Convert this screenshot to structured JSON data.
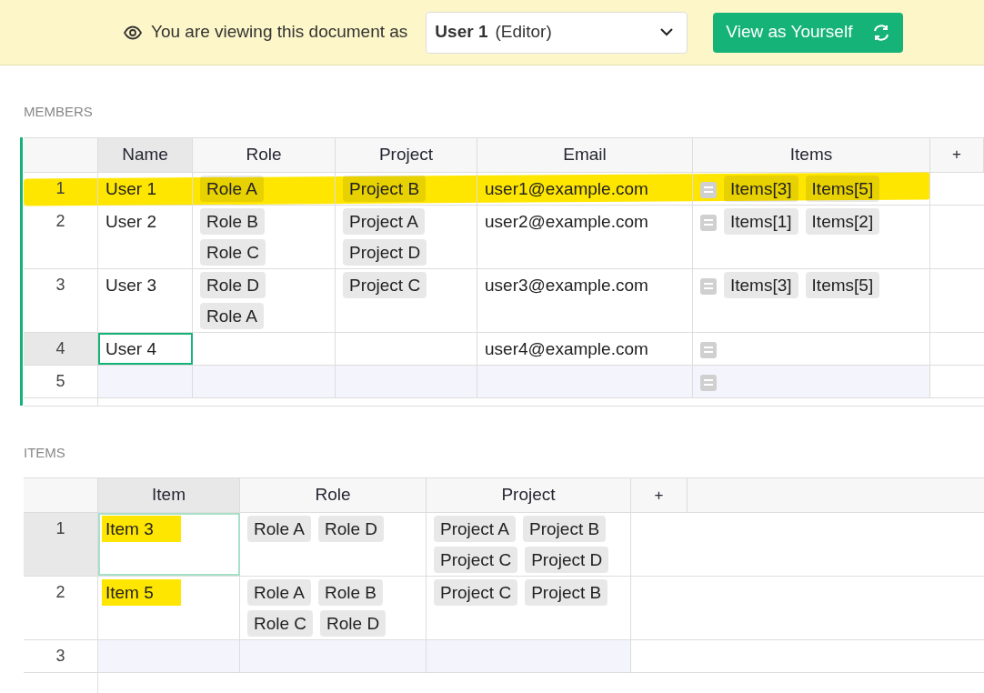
{
  "banner": {
    "message": "You are viewing this document as",
    "viewer": {
      "name": "User 1",
      "role": "(Editor)"
    },
    "button": "View as Yourself"
  },
  "tables": [
    {
      "title": "MEMBERS",
      "active": true,
      "add_column": "+",
      "columns": [
        {
          "label": "Name",
          "kind": "text",
          "selected": true
        },
        {
          "label": "Role",
          "kind": "chips",
          "selected": false
        },
        {
          "label": "Project",
          "kind": "chips",
          "selected": false
        },
        {
          "label": "Email",
          "kind": "text",
          "selected": false
        },
        {
          "label": "Items",
          "kind": "refs",
          "selected": false
        }
      ],
      "rows": [
        {
          "number": "1",
          "kind": "data",
          "selected": false,
          "highlighted": true,
          "cells": [
            "User 1",
            [
              "Role A"
            ],
            [
              "Project B"
            ],
            "user1@example.com",
            [
              "Items[3]",
              "Items[5]"
            ]
          ]
        },
        {
          "number": "2",
          "kind": "data",
          "selected": false,
          "highlighted": false,
          "cells": [
            "User 2",
            [
              "Role B",
              "Role C"
            ],
            [
              "Project A",
              "Project D"
            ],
            "user2@example.com",
            [
              "Items[1]",
              "Items[2]"
            ]
          ]
        },
        {
          "number": "3",
          "kind": "data",
          "selected": false,
          "highlighted": false,
          "cells": [
            "User 3",
            [
              "Role D",
              "Role A"
            ],
            [
              "Project C"
            ],
            "user3@example.com",
            [
              "Items[3]",
              "Items[5]"
            ]
          ]
        },
        {
          "number": "4",
          "kind": "data",
          "selected": true,
          "highlighted": false,
          "cells": [
            "User 4",
            [],
            [],
            "user4@example.com",
            []
          ]
        },
        {
          "number": "5",
          "kind": "new",
          "selected": false,
          "highlighted": false,
          "cells": [
            "",
            [],
            [],
            "",
            []
          ]
        }
      ]
    },
    {
      "title": "ITEMS",
      "active": false,
      "add_column": "+",
      "columns": [
        {
          "label": "Item",
          "kind": "text",
          "selected": true
        },
        {
          "label": "Role",
          "kind": "chips",
          "selected": false
        },
        {
          "label": "Project",
          "kind": "chips",
          "selected": false
        }
      ],
      "rows": [
        {
          "number": "1",
          "kind": "data",
          "selected": true,
          "highlighted": true,
          "cells": [
            "Item 3",
            [
              "Role A",
              "Role D"
            ],
            [
              "Project A",
              "Project B",
              "Project C",
              "Project D"
            ]
          ]
        },
        {
          "number": "2",
          "kind": "data",
          "selected": false,
          "highlighted": true,
          "cells": [
            "Item 5",
            [
              "Role A",
              "Role B",
              "Role C",
              "Role D"
            ],
            [
              "Project C",
              "Project B"
            ]
          ]
        },
        {
          "number": "3",
          "kind": "new",
          "selected": false,
          "highlighted": false,
          "cells": [
            "",
            [],
            []
          ]
        }
      ]
    }
  ]
}
